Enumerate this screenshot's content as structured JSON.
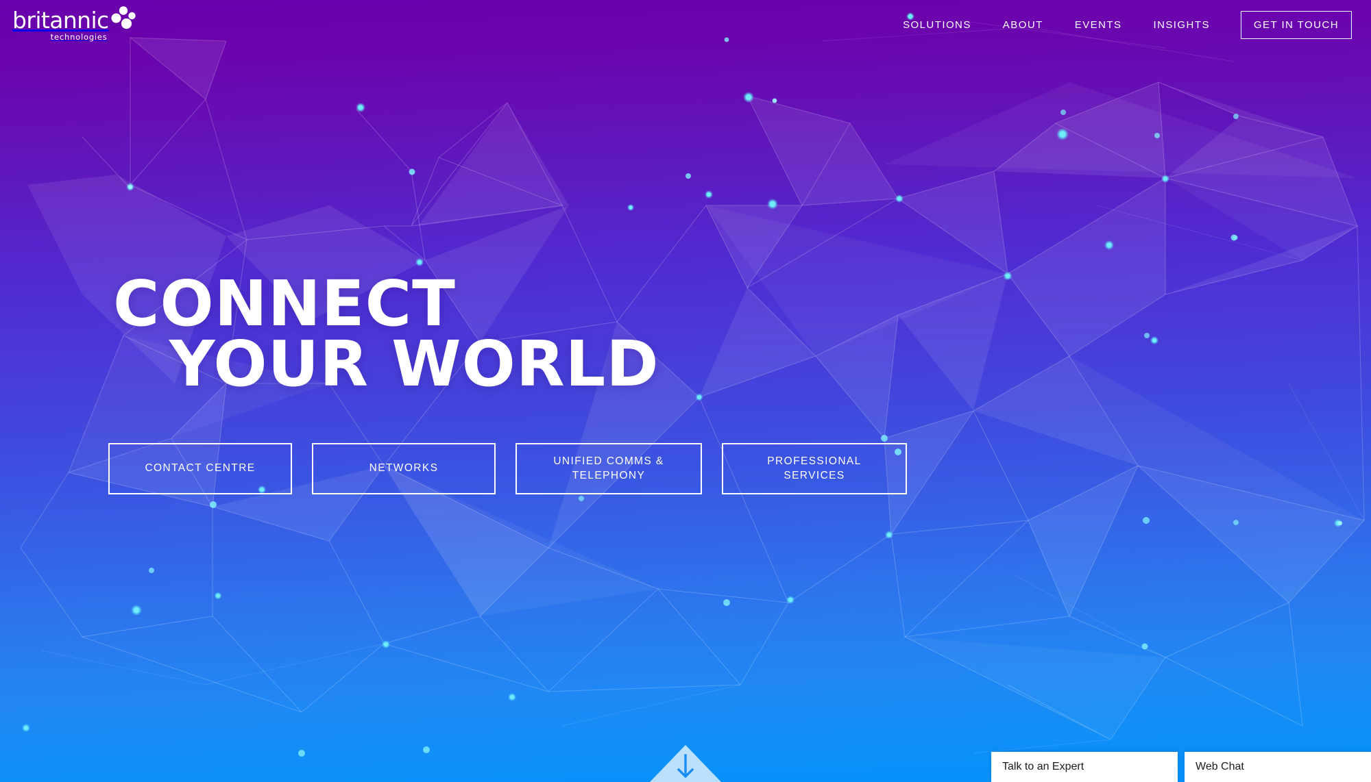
{
  "brand": {
    "name": "britannic",
    "tagline": "technologies",
    "logo_icon": "four-dot-cluster-icon"
  },
  "nav": {
    "links": [
      {
        "label": "SOLUTIONS",
        "name": "nav-link-solutions"
      },
      {
        "label": "ABOUT",
        "name": "nav-link-about"
      },
      {
        "label": "EVENTS",
        "name": "nav-link-events"
      },
      {
        "label": "INSIGHTS",
        "name": "nav-link-insights"
      }
    ],
    "cta": {
      "label": "GET IN TOUCH"
    }
  },
  "hero": {
    "headline_line1": "CONNECT",
    "headline_line2": "YOUR WORLD",
    "pills": [
      {
        "label": "CONTACT CENTRE"
      },
      {
        "label": "NETWORKS"
      },
      {
        "label_line1": "UNIFIED COMMS &",
        "label_line2": "TELEPHONY"
      },
      {
        "label_line1": "PROFESSIONAL",
        "label_line2": "SERVICES"
      }
    ],
    "scroll_cue_icon": "arrow-down-icon"
  },
  "chat_dock": {
    "expert_label": "Talk to an Expert",
    "webchat_label": "Web Chat"
  },
  "colors": {
    "gradient_top": "#6a00ab",
    "gradient_mid": "#4747db",
    "gradient_bottom": "#0090fa",
    "node_cyan": "#5ee9f5",
    "text_white": "#ffffff",
    "chat_tab_bg": "#ffffff",
    "chat_tab_text": "#1b1b1b"
  }
}
